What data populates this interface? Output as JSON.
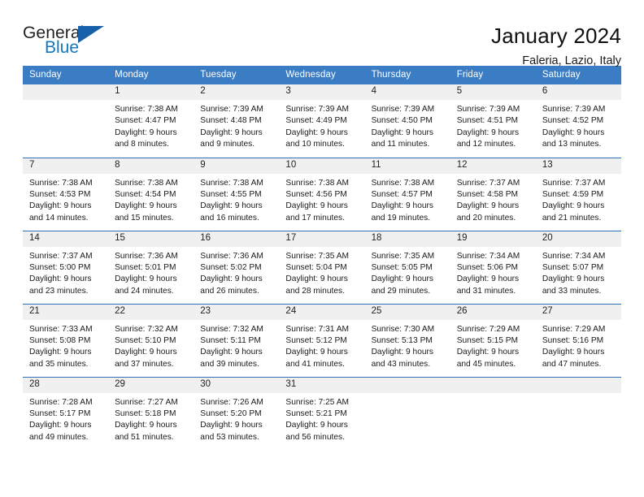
{
  "logo": {
    "word_one": "General",
    "word_two": "Blue",
    "triangle": "blue-triangle-icon",
    "accent_dark": "#1560a8",
    "accent_blue": "#1277bc"
  },
  "header": {
    "title": "January 2024",
    "subtitle": "Faleria, Lazio, Italy"
  },
  "theme": {
    "header_blue": "#3b7dc4",
    "row_divider_blue": "#2f6fb5",
    "daynum_band_gray": "#f0f0f0"
  },
  "weekdays": [
    "Sunday",
    "Monday",
    "Tuesday",
    "Wednesday",
    "Thursday",
    "Friday",
    "Saturday"
  ],
  "weeks": [
    [
      {
        "day": "",
        "sunrise": "",
        "sunset": "",
        "daylight_line1": "",
        "daylight_line2": ""
      },
      {
        "day": "1",
        "sunrise": "Sunrise: 7:38 AM",
        "sunset": "Sunset: 4:47 PM",
        "daylight_line1": "Daylight: 9 hours",
        "daylight_line2": "and 8 minutes."
      },
      {
        "day": "2",
        "sunrise": "Sunrise: 7:39 AM",
        "sunset": "Sunset: 4:48 PM",
        "daylight_line1": "Daylight: 9 hours",
        "daylight_line2": "and 9 minutes."
      },
      {
        "day": "3",
        "sunrise": "Sunrise: 7:39 AM",
        "sunset": "Sunset: 4:49 PM",
        "daylight_line1": "Daylight: 9 hours",
        "daylight_line2": "and 10 minutes."
      },
      {
        "day": "4",
        "sunrise": "Sunrise: 7:39 AM",
        "sunset": "Sunset: 4:50 PM",
        "daylight_line1": "Daylight: 9 hours",
        "daylight_line2": "and 11 minutes."
      },
      {
        "day": "5",
        "sunrise": "Sunrise: 7:39 AM",
        "sunset": "Sunset: 4:51 PM",
        "daylight_line1": "Daylight: 9 hours",
        "daylight_line2": "and 12 minutes."
      },
      {
        "day": "6",
        "sunrise": "Sunrise: 7:39 AM",
        "sunset": "Sunset: 4:52 PM",
        "daylight_line1": "Daylight: 9 hours",
        "daylight_line2": "and 13 minutes."
      }
    ],
    [
      {
        "day": "7",
        "sunrise": "Sunrise: 7:38 AM",
        "sunset": "Sunset: 4:53 PM",
        "daylight_line1": "Daylight: 9 hours",
        "daylight_line2": "and 14 minutes."
      },
      {
        "day": "8",
        "sunrise": "Sunrise: 7:38 AM",
        "sunset": "Sunset: 4:54 PM",
        "daylight_line1": "Daylight: 9 hours",
        "daylight_line2": "and 15 minutes."
      },
      {
        "day": "9",
        "sunrise": "Sunrise: 7:38 AM",
        "sunset": "Sunset: 4:55 PM",
        "daylight_line1": "Daylight: 9 hours",
        "daylight_line2": "and 16 minutes."
      },
      {
        "day": "10",
        "sunrise": "Sunrise: 7:38 AM",
        "sunset": "Sunset: 4:56 PM",
        "daylight_line1": "Daylight: 9 hours",
        "daylight_line2": "and 17 minutes."
      },
      {
        "day": "11",
        "sunrise": "Sunrise: 7:38 AM",
        "sunset": "Sunset: 4:57 PM",
        "daylight_line1": "Daylight: 9 hours",
        "daylight_line2": "and 19 minutes."
      },
      {
        "day": "12",
        "sunrise": "Sunrise: 7:37 AM",
        "sunset": "Sunset: 4:58 PM",
        "daylight_line1": "Daylight: 9 hours",
        "daylight_line2": "and 20 minutes."
      },
      {
        "day": "13",
        "sunrise": "Sunrise: 7:37 AM",
        "sunset": "Sunset: 4:59 PM",
        "daylight_line1": "Daylight: 9 hours",
        "daylight_line2": "and 21 minutes."
      }
    ],
    [
      {
        "day": "14",
        "sunrise": "Sunrise: 7:37 AM",
        "sunset": "Sunset: 5:00 PM",
        "daylight_line1": "Daylight: 9 hours",
        "daylight_line2": "and 23 minutes."
      },
      {
        "day": "15",
        "sunrise": "Sunrise: 7:36 AM",
        "sunset": "Sunset: 5:01 PM",
        "daylight_line1": "Daylight: 9 hours",
        "daylight_line2": "and 24 minutes."
      },
      {
        "day": "16",
        "sunrise": "Sunrise: 7:36 AM",
        "sunset": "Sunset: 5:02 PM",
        "daylight_line1": "Daylight: 9 hours",
        "daylight_line2": "and 26 minutes."
      },
      {
        "day": "17",
        "sunrise": "Sunrise: 7:35 AM",
        "sunset": "Sunset: 5:04 PM",
        "daylight_line1": "Daylight: 9 hours",
        "daylight_line2": "and 28 minutes."
      },
      {
        "day": "18",
        "sunrise": "Sunrise: 7:35 AM",
        "sunset": "Sunset: 5:05 PM",
        "daylight_line1": "Daylight: 9 hours",
        "daylight_line2": "and 29 minutes."
      },
      {
        "day": "19",
        "sunrise": "Sunrise: 7:34 AM",
        "sunset": "Sunset: 5:06 PM",
        "daylight_line1": "Daylight: 9 hours",
        "daylight_line2": "and 31 minutes."
      },
      {
        "day": "20",
        "sunrise": "Sunrise: 7:34 AM",
        "sunset": "Sunset: 5:07 PM",
        "daylight_line1": "Daylight: 9 hours",
        "daylight_line2": "and 33 minutes."
      }
    ],
    [
      {
        "day": "21",
        "sunrise": "Sunrise: 7:33 AM",
        "sunset": "Sunset: 5:08 PM",
        "daylight_line1": "Daylight: 9 hours",
        "daylight_line2": "and 35 minutes."
      },
      {
        "day": "22",
        "sunrise": "Sunrise: 7:32 AM",
        "sunset": "Sunset: 5:10 PM",
        "daylight_line1": "Daylight: 9 hours",
        "daylight_line2": "and 37 minutes."
      },
      {
        "day": "23",
        "sunrise": "Sunrise: 7:32 AM",
        "sunset": "Sunset: 5:11 PM",
        "daylight_line1": "Daylight: 9 hours",
        "daylight_line2": "and 39 minutes."
      },
      {
        "day": "24",
        "sunrise": "Sunrise: 7:31 AM",
        "sunset": "Sunset: 5:12 PM",
        "daylight_line1": "Daylight: 9 hours",
        "daylight_line2": "and 41 minutes."
      },
      {
        "day": "25",
        "sunrise": "Sunrise: 7:30 AM",
        "sunset": "Sunset: 5:13 PM",
        "daylight_line1": "Daylight: 9 hours",
        "daylight_line2": "and 43 minutes."
      },
      {
        "day": "26",
        "sunrise": "Sunrise: 7:29 AM",
        "sunset": "Sunset: 5:15 PM",
        "daylight_line1": "Daylight: 9 hours",
        "daylight_line2": "and 45 minutes."
      },
      {
        "day": "27",
        "sunrise": "Sunrise: 7:29 AM",
        "sunset": "Sunset: 5:16 PM",
        "daylight_line1": "Daylight: 9 hours",
        "daylight_line2": "and 47 minutes."
      }
    ],
    [
      {
        "day": "28",
        "sunrise": "Sunrise: 7:28 AM",
        "sunset": "Sunset: 5:17 PM",
        "daylight_line1": "Daylight: 9 hours",
        "daylight_line2": "and 49 minutes."
      },
      {
        "day": "29",
        "sunrise": "Sunrise: 7:27 AM",
        "sunset": "Sunset: 5:18 PM",
        "daylight_line1": "Daylight: 9 hours",
        "daylight_line2": "and 51 minutes."
      },
      {
        "day": "30",
        "sunrise": "Sunrise: 7:26 AM",
        "sunset": "Sunset: 5:20 PM",
        "daylight_line1": "Daylight: 9 hours",
        "daylight_line2": "and 53 minutes."
      },
      {
        "day": "31",
        "sunrise": "Sunrise: 7:25 AM",
        "sunset": "Sunset: 5:21 PM",
        "daylight_line1": "Daylight: 9 hours",
        "daylight_line2": "and 56 minutes."
      },
      {
        "day": "",
        "sunrise": "",
        "sunset": "",
        "daylight_line1": "",
        "daylight_line2": ""
      },
      {
        "day": "",
        "sunrise": "",
        "sunset": "",
        "daylight_line1": "",
        "daylight_line2": ""
      },
      {
        "day": "",
        "sunrise": "",
        "sunset": "",
        "daylight_line1": "",
        "daylight_line2": ""
      }
    ]
  ]
}
